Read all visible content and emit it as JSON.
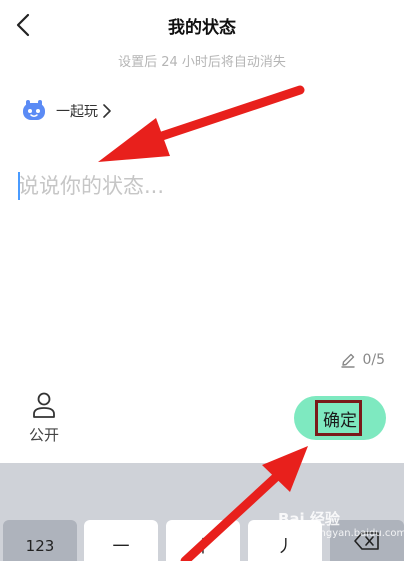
{
  "header": {
    "back_icon": "chevron-left-icon",
    "title": "我的状态",
    "subtitle": "设置后 24 小时后将自动消失"
  },
  "activity": {
    "icon": "game-controller-icon",
    "label": "一起玩",
    "chevron": "chevron-right-icon"
  },
  "status": {
    "placeholder": "说说你的状态...",
    "value": ""
  },
  "counter": {
    "icon": "pencil-icon",
    "text": "0/5"
  },
  "privacy": {
    "icon": "person-icon",
    "label": "公开"
  },
  "confirm": {
    "label": "确定",
    "color": "#7ee9c0"
  },
  "keyboard": {
    "keys": [
      "123",
      "一",
      "丨",
      "丿",
      "delete-icon"
    ]
  },
  "watermark": {
    "brand": "Bai 经验",
    "url": "jingyan.baidu.com"
  },
  "annotation": {
    "arrow_color": "#e8201c"
  }
}
